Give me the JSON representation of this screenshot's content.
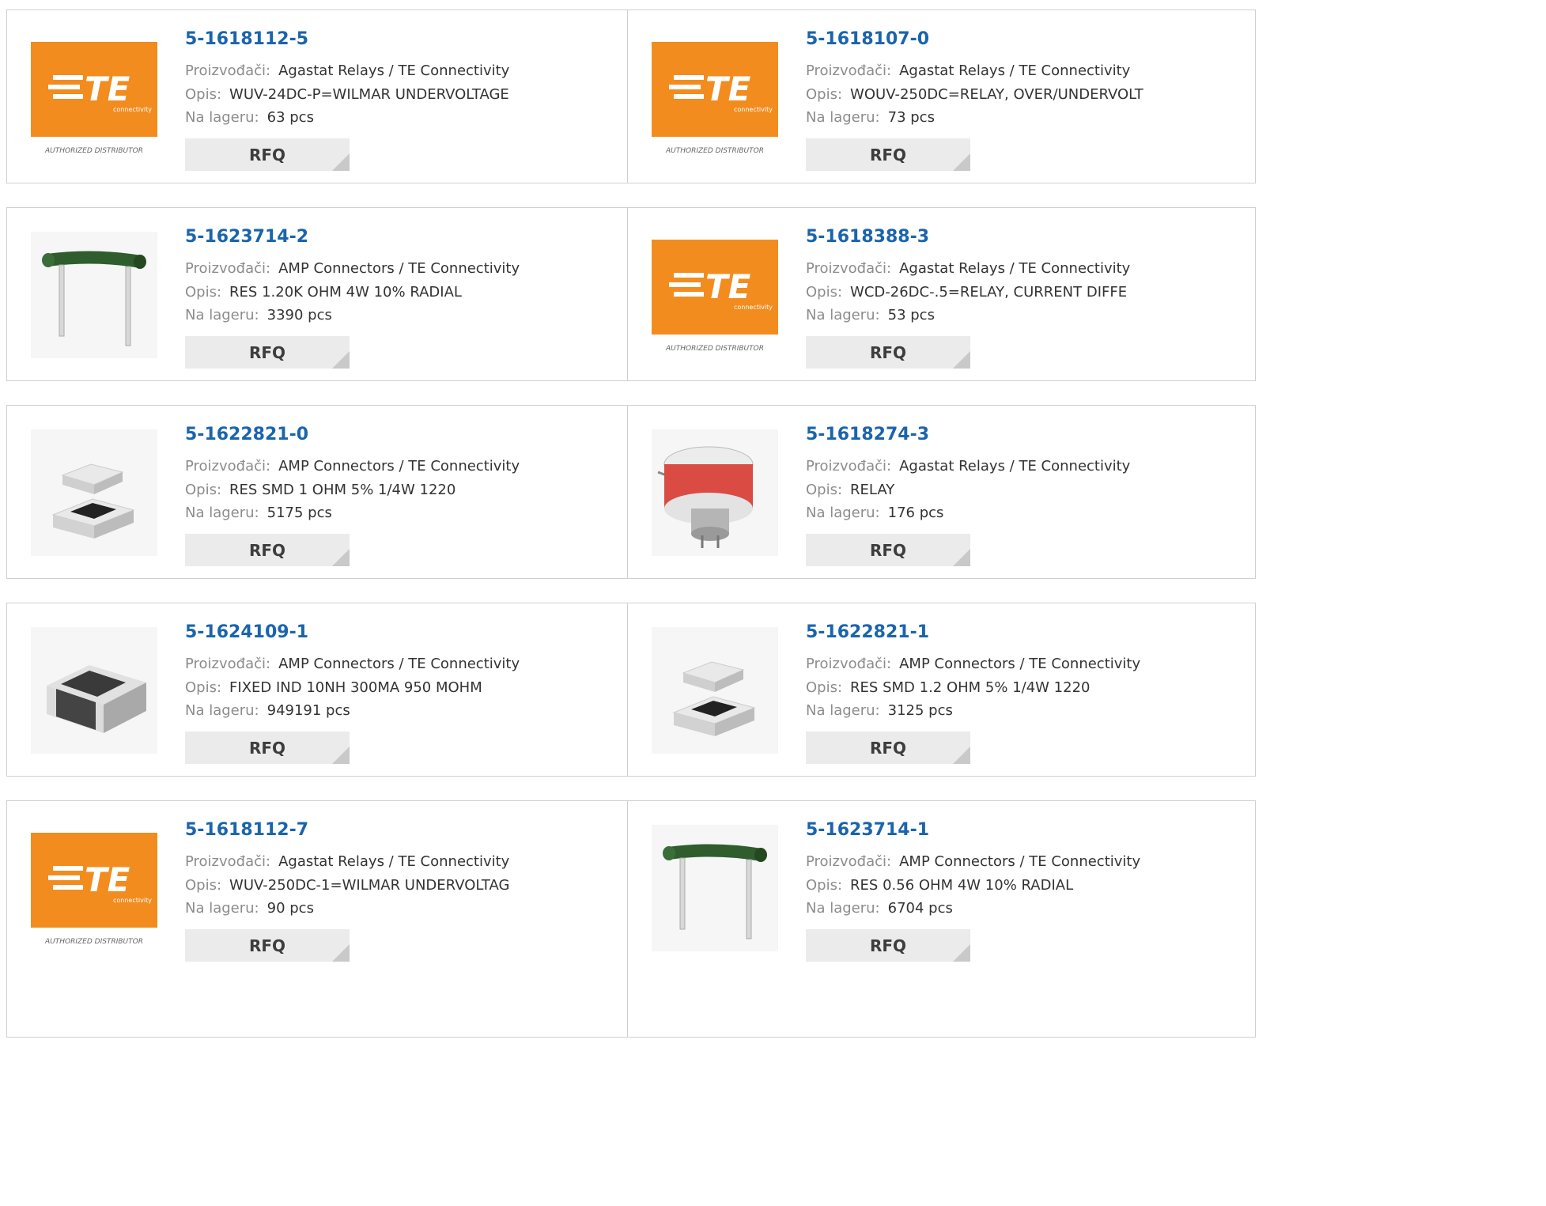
{
  "labels": {
    "manufacturer": "Proizvođači:",
    "description": "Opis:",
    "stock": "Na lageru:",
    "rfq": "RFQ"
  },
  "brand": {
    "te_text": "TE",
    "te_sub": "connectivity",
    "authorized": "AUTHORIZED DISTRIBUTOR",
    "orange": "#f28c1e",
    "link_blue": "#1a64ad"
  },
  "rows": [
    {
      "cards": [
        {
          "part": "5-1618112-5",
          "manufacturer": "Agastat Relays / TE Connectivity",
          "description": "WUV-24DC-P=WILMAR UNDERVOLTAGE",
          "stock": "63 pcs",
          "image": "te-logo"
        },
        {
          "part": "5-1618107-0",
          "manufacturer": "Agastat Relays / TE Connectivity",
          "description": "WOUV-250DC=RELAY, OVER/UNDERVOLT",
          "stock": "73 pcs",
          "image": "te-logo"
        }
      ]
    },
    {
      "cards": [
        {
          "part": "5-1623714-2",
          "manufacturer": "AMP Connectors / TE Connectivity",
          "description": "RES 1.20K OHM 4W 10% RADIAL",
          "stock": "3390 pcs",
          "image": "radial-resistor"
        },
        {
          "part": "5-1618388-3",
          "manufacturer": "Agastat Relays / TE Connectivity",
          "description": "WCD-26DC-.5=RELAY, CURRENT DIFFE",
          "stock": "53 pcs",
          "image": "te-logo"
        }
      ]
    },
    {
      "cards": [
        {
          "part": "5-1622821-0",
          "manufacturer": "AMP Connectors / TE Connectivity",
          "description": "RES SMD 1 OHM 5% 1/4W 1220",
          "stock": "5175 pcs",
          "image": "smd-resistor-pair"
        },
        {
          "part": "5-1618274-3",
          "manufacturer": "Agastat Relays / TE Connectivity",
          "description": "RELAY",
          "stock": "176 pcs",
          "image": "relay"
        }
      ]
    },
    {
      "cards": [
        {
          "part": "5-1624109-1",
          "manufacturer": "AMP Connectors / TE Connectivity",
          "description": "FIXED IND 10NH 300MA 950 MOHM",
          "stock": "949191 pcs",
          "image": "smd-chip"
        },
        {
          "part": "5-1622821-1",
          "manufacturer": "AMP Connectors / TE Connectivity",
          "description": "RES SMD 1.2 OHM 5% 1/4W 1220",
          "stock": "3125 pcs",
          "image": "smd-resistor-pair"
        }
      ]
    },
    {
      "cards": [
        {
          "part": "5-1618112-7",
          "manufacturer": "Agastat Relays / TE Connectivity",
          "description": "WUV-250DC-1=WILMAR UNDERVOLTAG",
          "stock": "90 pcs",
          "image": "te-logo"
        },
        {
          "part": "5-1623714-1",
          "manufacturer": "AMP Connectors / TE Connectivity",
          "description": "RES 0.56 OHM 4W 10% RADIAL",
          "stock": "6704 pcs",
          "image": "radial-resistor"
        }
      ]
    }
  ]
}
